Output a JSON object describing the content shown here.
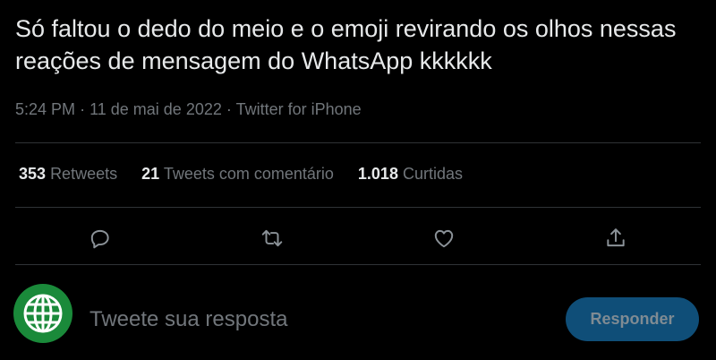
{
  "tweet": {
    "text": "Só faltou o dedo do meio e o emoji revirando os olhos nessas reações de mensagem do WhatsApp kkkkkk",
    "time": "5:24 PM",
    "date": "11 de mai de 2022",
    "source": "Twitter for iPhone",
    "separator": "·"
  },
  "stats": {
    "retweets": {
      "count": "353",
      "label": "Retweets"
    },
    "quotes": {
      "count": "21",
      "label": "Tweets com comentário"
    },
    "likes": {
      "count": "1.018",
      "label": "Curtidas"
    }
  },
  "actions": {
    "reply_icon": "speech-bubble-icon",
    "retweet_icon": "retweet-arrows-icon",
    "like_icon": "heart-icon",
    "share_icon": "share-upload-icon"
  },
  "reply": {
    "placeholder": "Tweete sua resposta",
    "button_label": "Responder"
  },
  "colors": {
    "background": "#000000",
    "text": "#e7e9ea",
    "muted": "#71767b",
    "button_bg": "#0f4e78",
    "avatar_bg": "#1a8a3a"
  }
}
